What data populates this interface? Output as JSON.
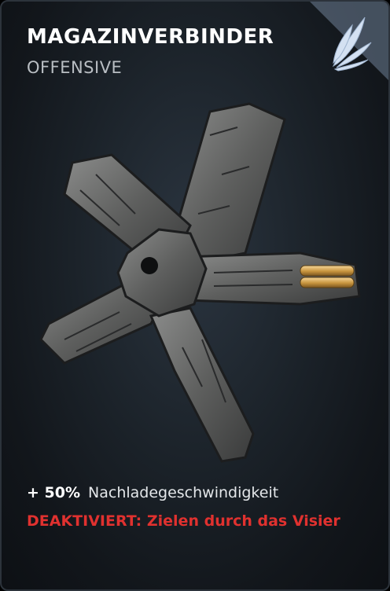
{
  "card": {
    "title": "MAGAZINVERBINDER",
    "category": "OFFENSIVE",
    "emblem_icon": "wing-icon",
    "item_image": "magazine-coupler-artwork"
  },
  "stats": {
    "bonus_value": "+ 50%",
    "bonus_label": "Nachladegeschwindigkeit",
    "disabled_text": "DEAKTIVIERT: Zielen durch das Visier"
  },
  "colors": {
    "background": "#151b21",
    "title": "#ffffff",
    "subtitle": "#b9bec3",
    "disabled": "#e0312f",
    "emblem": "#c9d9ef"
  }
}
